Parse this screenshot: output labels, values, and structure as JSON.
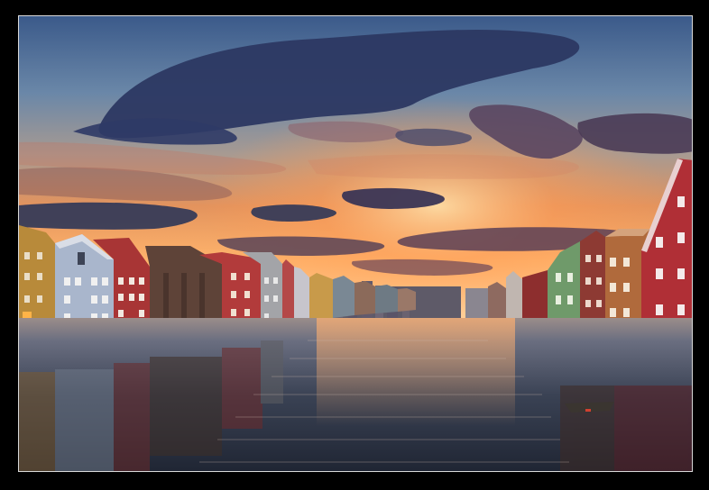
{
  "photo": {
    "subject": "",
    "palette": {
      "sky_top": "#3f5f8f",
      "sky_mid": "#7a8fa8",
      "sunset_glow": "#f08a4a",
      "horizon": "#ffb070",
      "water": "#2c3645",
      "clouds_dark": "#2b3558",
      "clouds_lit": "#b7655a",
      "frame_border": "#d8d8d8",
      "background": "#000000"
    }
  }
}
